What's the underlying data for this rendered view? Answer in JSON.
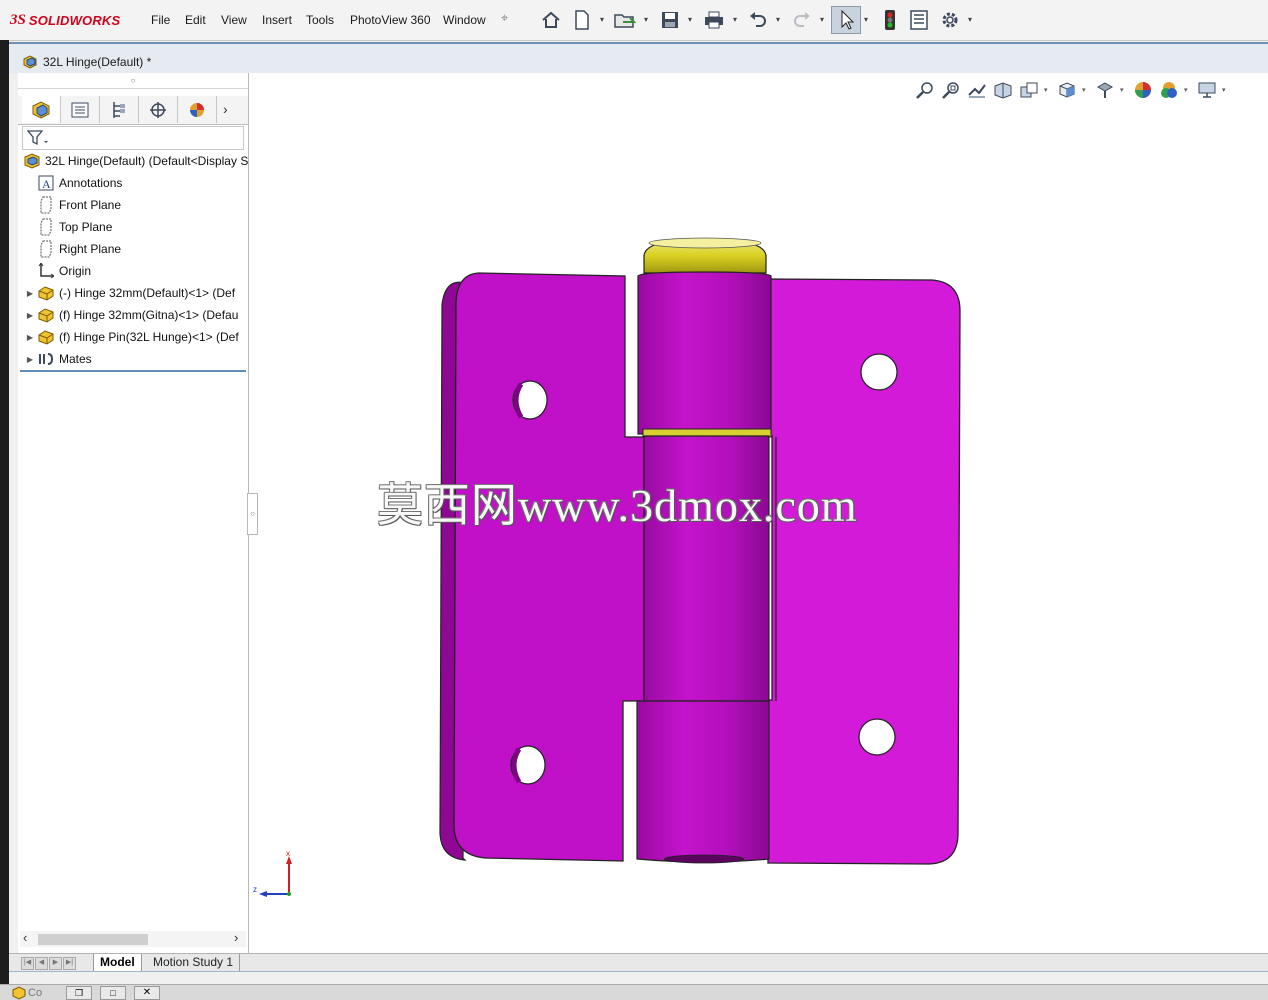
{
  "app": {
    "brand_prefix": "3S",
    "brand_name": "SOLIDWORKS"
  },
  "menu": [
    "File",
    "Edit",
    "View",
    "Insert",
    "Tools",
    "PhotoView 360",
    "Window"
  ],
  "toolbar_icons": [
    "home-icon",
    "new-document-icon",
    "open-icon",
    "save-icon",
    "print-icon",
    "undo-icon",
    "redo-icon",
    "select-icon",
    "traffic-light-icon",
    "file-properties-icon",
    "options-gear-icon"
  ],
  "document": {
    "title": "32L Hinge(Default) *"
  },
  "manager_tabs": [
    "feature-manager-tab",
    "property-manager-tab",
    "configuration-manager-tab",
    "dimxpert-manager-tab",
    "display-manager-tab"
  ],
  "tree": {
    "root": "32L Hinge(Default)  (Default<Display S",
    "items": [
      {
        "label": "Annotations",
        "icon": "annotations-icon",
        "expandable": false
      },
      {
        "label": "Front Plane",
        "icon": "plane-icon",
        "expandable": false
      },
      {
        "label": "Top Plane",
        "icon": "plane-icon",
        "expandable": false
      },
      {
        "label": "Right Plane",
        "icon": "plane-icon",
        "expandable": false
      },
      {
        "label": "Origin",
        "icon": "origin-icon",
        "expandable": false
      },
      {
        "label": "(-) Hinge 32mm(Default)<1> (Def",
        "icon": "part-icon",
        "expandable": true
      },
      {
        "label": "(f) Hinge 32mm(Gitna)<1> (Defau",
        "icon": "part-icon",
        "expandable": true
      },
      {
        "label": "(f) Hinge Pin(32L Hunge)<1> (Def",
        "icon": "part-icon",
        "expandable": true
      },
      {
        "label": "Mates",
        "icon": "mates-icon",
        "expandable": true
      }
    ]
  },
  "bottom_tabs": {
    "model": "Model",
    "motion": "Motion Study 1"
  },
  "graphics": {
    "watermark": "莫西网www.3dmox.com",
    "triad": {
      "x_label": "x",
      "z_label": "z"
    },
    "colors": {
      "hinge_leaf": "#c010c8",
      "hinge_leaf_light": "#d21ad8",
      "pin_cap": "#d9d020"
    }
  },
  "taskbar": {
    "item_label": "Co"
  }
}
